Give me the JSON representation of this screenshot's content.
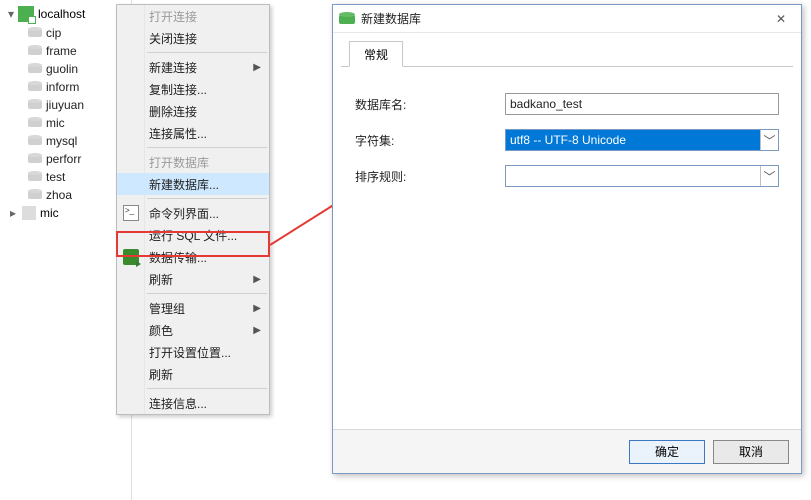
{
  "tree": {
    "root": {
      "label": "localhost"
    },
    "databases": [
      {
        "label": "cip"
      },
      {
        "label": "frame"
      },
      {
        "label": "guolin"
      },
      {
        "label": "inform"
      },
      {
        "label": "jiuyuan"
      },
      {
        "label": "mic"
      },
      {
        "label": "mysql"
      },
      {
        "label": "perforr"
      },
      {
        "label": "test"
      },
      {
        "label": "zhoa"
      }
    ],
    "extra": {
      "label": "mic"
    }
  },
  "context_menu": {
    "open_conn": "打开连接",
    "close_conn": "关闭连接",
    "new_conn": "新建连接",
    "dup_conn": "复制连接...",
    "del_conn": "删除连接",
    "conn_props": "连接属性...",
    "open_db": "打开数据库",
    "new_db": "新建数据库...",
    "cmd": "命令列界面...",
    "run_sql": "运行 SQL 文件...",
    "transfer": "数据传输...",
    "refresh1": "刷新",
    "manage_group": "管理组",
    "color": "颜色",
    "open_settings": "打开设置位置...",
    "refresh2": "刷新",
    "conn_info": "连接信息..."
  },
  "dialog": {
    "title": "新建数据库",
    "tab_general": "常规",
    "label_db_name": "数据库名:",
    "label_charset": "字符集:",
    "label_collation": "排序规则:",
    "db_name_value": "badkano_test",
    "charset_value": "utf8 -- UTF-8 Unicode",
    "collation_value": "",
    "btn_ok": "确定",
    "btn_cancel": "取消"
  }
}
